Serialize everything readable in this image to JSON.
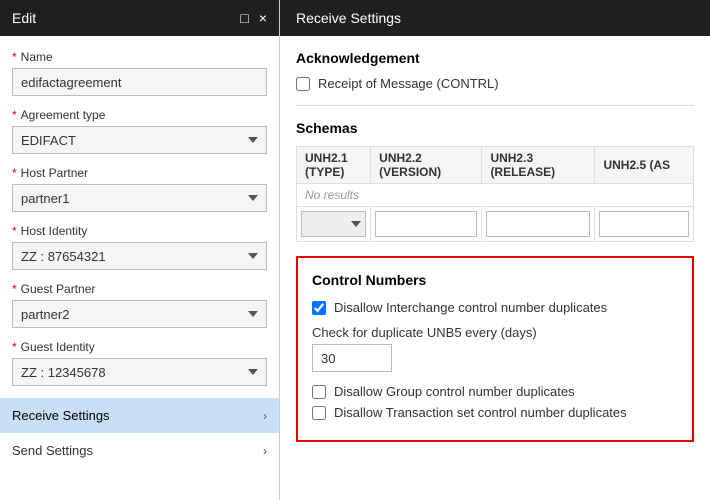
{
  "left": {
    "header": {
      "title": "Edit",
      "minimize_icon": "□",
      "close_icon": "×"
    },
    "fields": {
      "name_label": "Name",
      "name_value": "edifactagreement",
      "agreement_type_label": "Agreement type",
      "agreement_type_value": "EDIFACT",
      "host_partner_label": "Host Partner",
      "host_partner_value": "partner1",
      "host_identity_label": "Host Identity",
      "host_identity_value": "ZZ : 87654321",
      "guest_partner_label": "Guest Partner",
      "guest_partner_value": "partner2",
      "guest_identity_label": "Guest Identity",
      "guest_identity_value": "ZZ : 12345678"
    },
    "nav": {
      "receive_settings_label": "Receive Settings",
      "send_settings_label": "Send Settings"
    }
  },
  "right": {
    "header": {
      "title": "Receive Settings"
    },
    "acknowledgement": {
      "section_title": "Acknowledgement",
      "receipt_of_message_label": "Receipt of Message (CONTRL)"
    },
    "schemas": {
      "section_title": "Schemas",
      "columns": [
        "UNH2.1 (TYPE)",
        "UNH2.2 (VERSION)",
        "UNH2.3 (RELEASE)",
        "UNH2.5 (AS"
      ],
      "no_results_text": "No results"
    },
    "control_numbers": {
      "section_title": "Control Numbers",
      "interchange_label": "Disallow Interchange control number duplicates",
      "interchange_checked": true,
      "check_days_label": "Check for duplicate UNB5 every (days)",
      "check_days_value": "30",
      "group_label": "Disallow Group control number duplicates",
      "group_checked": false,
      "transaction_label": "Disallow Transaction set control number duplicates",
      "transaction_checked": false
    }
  }
}
